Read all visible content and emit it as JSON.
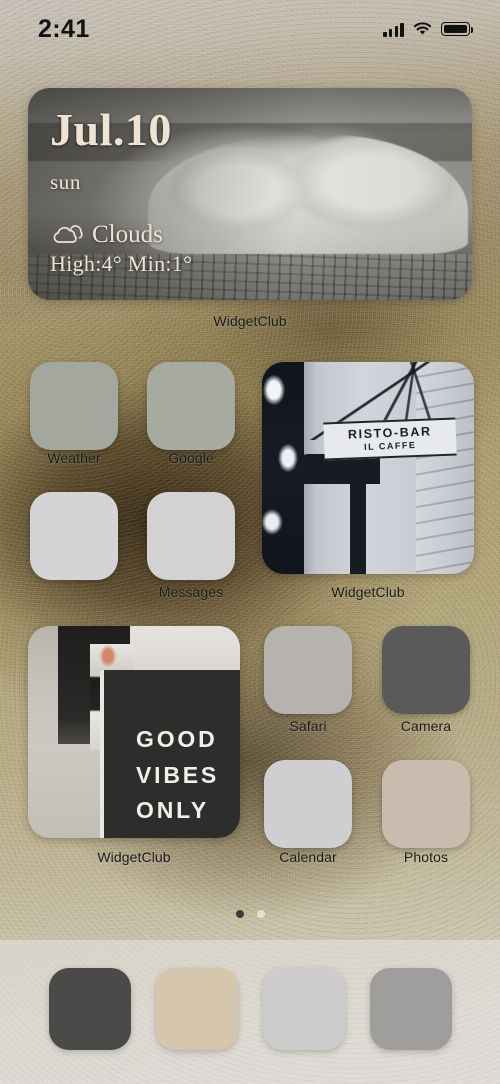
{
  "status_bar": {
    "time": "2:41",
    "signal_icon": "cellular-bars-icon",
    "wifi_icon": "wifi-icon",
    "battery_icon": "battery-full-icon"
  },
  "weather_widget": {
    "date": "Jul.10",
    "day": "sun",
    "condition": "Clouds",
    "condition_icon": "cloud-icon",
    "temperature": "High:4° Min:1°",
    "label": "WidgetClub"
  },
  "apps": [
    {
      "name": "Weather",
      "label": "Weather",
      "color": "#a3a79d"
    },
    {
      "name": "Google",
      "label": "Google",
      "color": "#a6aaa0"
    },
    {
      "name": "Unnamed",
      "label": "",
      "color": "#d4d4d6"
    },
    {
      "name": "Messages",
      "label": "Messages",
      "color": "#d2d2d4"
    },
    {
      "name": "Safari",
      "label": "Safari",
      "color": "#b6b2ae"
    },
    {
      "name": "Camera",
      "label": "Camera",
      "color": "#5a5a58"
    },
    {
      "name": "Calendar",
      "label": "Calendar",
      "color": "#cfcfd1"
    },
    {
      "name": "Photos",
      "label": "Photos",
      "color": "#c9bcae"
    }
  ],
  "photo_widgets": {
    "risto": {
      "label": "WidgetClub",
      "sign_line1": "RISTO-BAR",
      "sign_line2": "IL CAFFE"
    },
    "vibes": {
      "label": "WidgetClub",
      "line1": "GOOD",
      "line2": "VIBES",
      "line3": "ONLY"
    }
  },
  "page_dots": {
    "total": 2,
    "active_index": 0
  },
  "dock": {
    "icons": [
      {
        "name": "dock-app-1",
        "color": "#4a4a48"
      },
      {
        "name": "dock-app-2",
        "color": "#d6c6ae"
      },
      {
        "name": "dock-app-3",
        "color": "#cdcdcd"
      },
      {
        "name": "dock-app-4",
        "color": "#a09e9c"
      }
    ]
  },
  "theme": {
    "wallpaper_accent": "#a89a78",
    "label_color": "#1a1a1a"
  }
}
